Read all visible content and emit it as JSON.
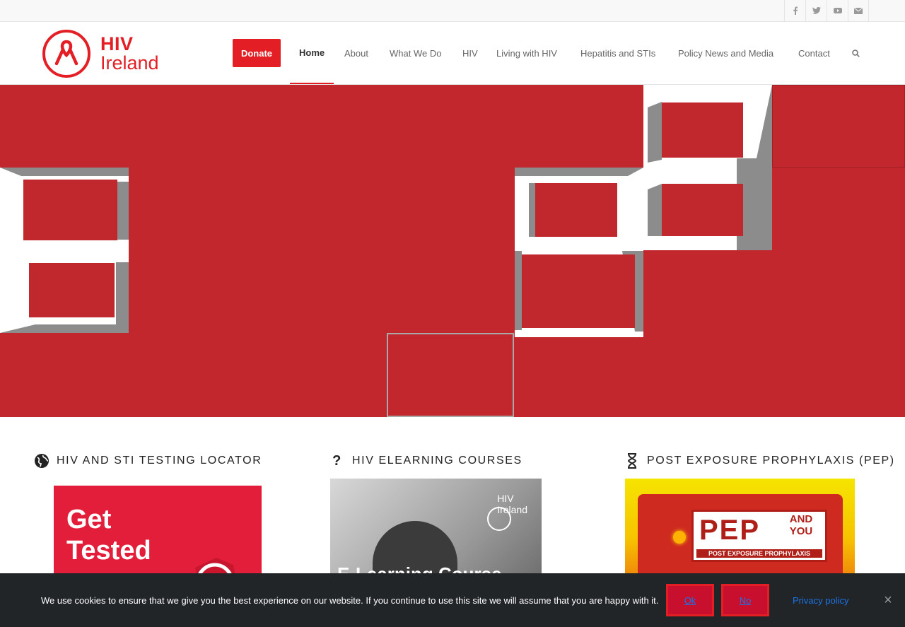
{
  "topbar": {
    "social": [
      "facebook-icon",
      "twitter-icon",
      "youtube-icon",
      "mail-icon"
    ]
  },
  "header": {
    "logo": {
      "line1": "HIV",
      "line2": "Ireland"
    },
    "donate_label": "Donate",
    "nav": [
      "Home",
      "About",
      "What We Do",
      "HIV",
      "Living with HIV",
      "Hepatitis and STIs",
      "Policy News and Media",
      "Contact"
    ],
    "active_nav": "Home"
  },
  "columns": [
    {
      "title": "HIV AND STI TESTING LOCATOR",
      "icon": "globe-icon"
    },
    {
      "title": "HIV ELEARNING COURSES",
      "icon": "question-icon"
    },
    {
      "title": "POST EXPOSURE PROPHYLAXIS (PEP)",
      "icon": "hourglass-icon"
    }
  ],
  "cards": {
    "tested": {
      "line1": "Get",
      "line2": "Tested"
    },
    "elearn": {
      "logo1": "HIV",
      "logo2": "Ireland",
      "course": "E-Learning Course"
    },
    "pep": {
      "title": "PEP",
      "and": "AND YOU",
      "sub": "POST EXPOSURE PROPHYLAXIS"
    }
  },
  "cookie": {
    "text": "We use cookies to ensure that we give you the best experience on our website. If you continue to use this site we will assume that you are happy with it.",
    "ok_label": "Ok",
    "no_label": "No",
    "privacy_label": "Privacy policy"
  },
  "colors": {
    "brand_red": "#e31e24",
    "slider_red": "#c1272d",
    "cookie_bg": "#222528"
  }
}
